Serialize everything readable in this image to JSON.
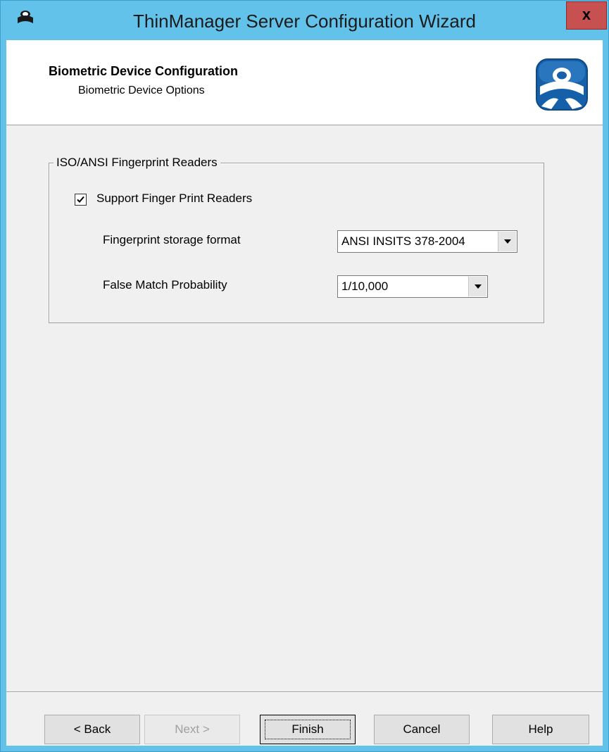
{
  "window": {
    "title": "ThinManager Server Configuration Wizard",
    "close_label": "x"
  },
  "header": {
    "title": "Biometric Device Configuration",
    "subtitle": "Biometric Device Options"
  },
  "group": {
    "legend": "ISO/ANSI Fingerprint Readers",
    "support_checkbox": {
      "label": "Support Finger Print Readers",
      "checked": true
    },
    "storage_format": {
      "label": "Fingerprint storage format",
      "value": "ANSI INSITS 378-2004"
    },
    "false_match": {
      "label": "False Match Probability",
      "value": "1/10,000"
    }
  },
  "buttons": {
    "back": "< Back",
    "next": "Next >",
    "finish": "Finish",
    "cancel": "Cancel",
    "help": "Help"
  },
  "icons": {
    "app": "thinmanager-app-icon",
    "logo": "thinmanager-logo-icon",
    "close": "close-icon",
    "dropdown": "chevron-down-icon",
    "check": "checkmark-icon"
  },
  "colors": {
    "titlebar": "#62c2ea",
    "close_button": "#c75050",
    "logo_blue": "#1560a8"
  }
}
